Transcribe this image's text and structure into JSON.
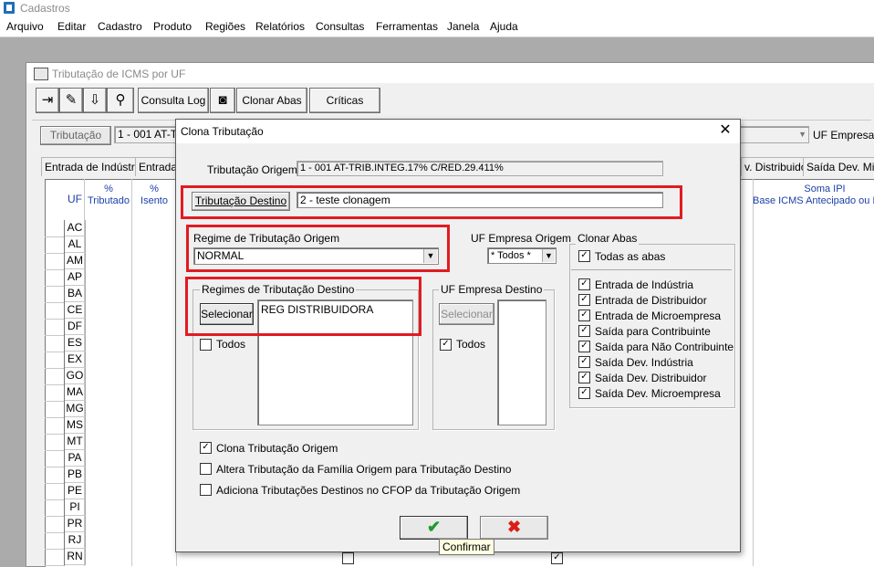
{
  "app": {
    "title": "Cadastros"
  },
  "menu": [
    "Arquivo",
    "Editar",
    "Cadastro",
    "Produto",
    "Regiões",
    "Relatórios",
    "Consultas",
    "Ferramentas",
    "Janela",
    "Ajuda"
  ],
  "child": {
    "title": "Tributação de ICMS por UF",
    "toolbar": {
      "consulta_log": "Consulta Log",
      "clonar_abas": "Clonar Abas",
      "criticas": "Críticas"
    },
    "tributacao_button": "Tributação",
    "tributacao_value": "1 - 001 AT-T",
    "uf_empresa_label": "UF Empresa",
    "tabs": [
      "Entrada de Indústria",
      "Entrada",
      "v. Distribuidor",
      "Saída Dev. Mic"
    ],
    "grid_headers": {
      "uf": "UF",
      "tributado": "%\nTributado",
      "isento": "%\nIsento",
      "soma_ipi": "Soma IPI",
      "base_icms": "Base ICMS Antecipado ou F"
    },
    "ufs": [
      "AC",
      "AL",
      "AM",
      "AP",
      "BA",
      "CE",
      "DF",
      "ES",
      "EX",
      "GO",
      "MA",
      "MG",
      "MS",
      "MT",
      "PA",
      "PB",
      "PE",
      "PI",
      "PR",
      "RJ",
      "RN"
    ]
  },
  "dialog": {
    "title": "Clona Tributação",
    "tributacao_origem_label": "Tributação Origem",
    "tributacao_origem_value": "1  -  001 AT-TRIB.INTEG.17% C/RED.29.411%",
    "tributacao_destino_button": "Tributação Destino",
    "tributacao_destino_value": "2  -  teste clonagem",
    "regime_origem_label": "Regime de Tributação Origem",
    "regime_origem_value": "NORMAL",
    "uf_empresa_origem_label": "UF Empresa Origem",
    "uf_empresa_origem_value": "* Todos *",
    "regimes_destino_label": "Regimes de Tributação Destino",
    "regimes_selecionar": "Selecionar",
    "regimes_todos": "Todos",
    "regimes_list": [
      "REG DISTRIBUIDORA"
    ],
    "uf_empresa_destino_label": "UF Empresa Destino",
    "uf_selecionar": "Selecionar",
    "uf_todos": "Todos",
    "clonar_abas_label": "Clonar Abas",
    "todas_abas": "Todas as abas",
    "abas": [
      "Entrada de Indústria",
      "Entrada de Distribuidor",
      "Entrada de Microempresa",
      "Saída para Contribuinte",
      "Saída para Não Contribuinte",
      "Saída Dev. Indústria",
      "Saída Dev. Distribuidor",
      "Saída Dev. Microempresa"
    ],
    "opt_clona": "Clona Tributação Origem",
    "opt_altera": "Altera Tributação da Família Origem para Tributação Destino",
    "opt_adiciona": "Adiciona Tributações Destinos no CFOP da Tributação Origem",
    "confirm_tooltip": "Confirmar"
  },
  "colors": {
    "highlight": "#e11b22",
    "header_blue": "#1b3fa8",
    "ok_green": "#1e9a2c",
    "cancel_red": "#d91e18"
  }
}
